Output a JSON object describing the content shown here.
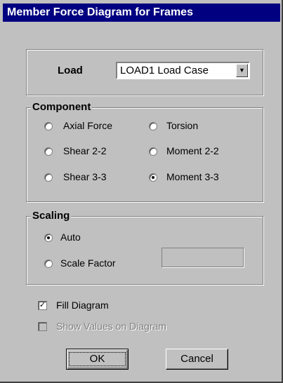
{
  "window": {
    "title": "Member Force Diagram for Frames"
  },
  "load": {
    "label": "Load",
    "selected": "LOAD1 Load Case",
    "dropdown_icon": "chevron-down-icon"
  },
  "component": {
    "legend": "Component",
    "options": [
      {
        "label": "Axial Force",
        "selected": false
      },
      {
        "label": "Torsion",
        "selected": false
      },
      {
        "label": "Shear 2-2",
        "selected": false
      },
      {
        "label": "Moment 2-2",
        "selected": false
      },
      {
        "label": "Shear 3-3",
        "selected": false
      },
      {
        "label": "Moment 3-3",
        "selected": true
      }
    ]
  },
  "scaling": {
    "legend": "Scaling",
    "auto_label": "Auto",
    "auto_selected": true,
    "factor_label": "Scale Factor",
    "factor_selected": false,
    "factor_value": ""
  },
  "options": {
    "fill_diagram_label": "Fill Diagram",
    "fill_diagram_checked": true,
    "show_values_label": "Show Values on Diagram",
    "show_values_checked": false
  },
  "buttons": {
    "ok": "OK",
    "cancel": "Cancel"
  },
  "colors": {
    "titlebar": "#000080",
    "face": "#c0c0c0"
  }
}
